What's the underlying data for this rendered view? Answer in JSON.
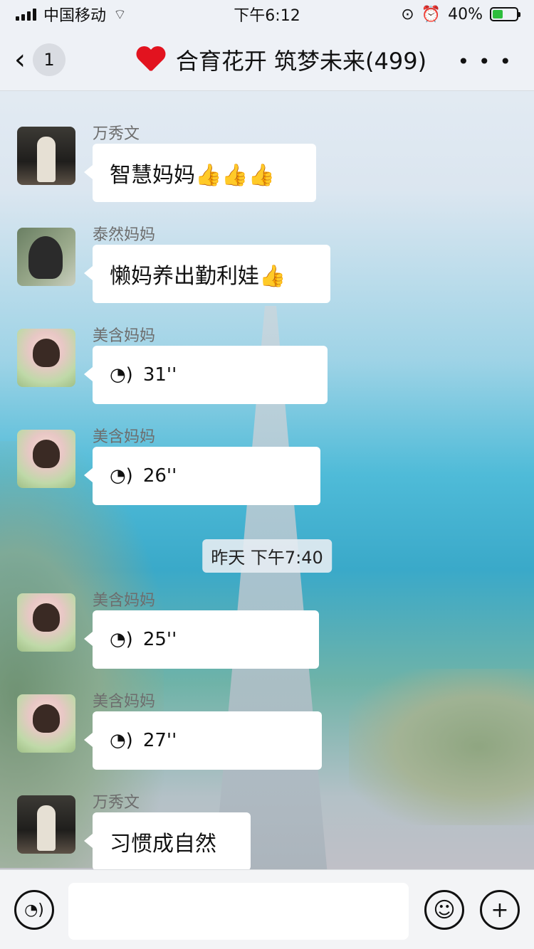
{
  "status": {
    "carrier": "中国移动",
    "time": "下午6:12",
    "battery": "40%"
  },
  "nav": {
    "unread": "1",
    "title": "合育花开 筑梦未来(499)"
  },
  "messages": [
    {
      "sender": "万秀文",
      "text": "智慧妈妈👍👍👍"
    },
    {
      "sender": "泰然妈妈",
      "text": "懒妈养出勤利娃👍"
    },
    {
      "sender": "美含妈妈",
      "voice": "31''"
    },
    {
      "sender": "美含妈妈",
      "voice": "26''"
    },
    {
      "time": "昨天 下午7:40"
    },
    {
      "sender": "美含妈妈",
      "voice": "25''"
    },
    {
      "sender": "美含妈妈",
      "voice": "27''"
    },
    {
      "sender": "万秀文",
      "text": "习惯成自然"
    }
  ],
  "icons": {
    "voice": "voice-icon",
    "emoji": "emoji-icon",
    "add": "add-icon",
    "more": "more-icon"
  }
}
